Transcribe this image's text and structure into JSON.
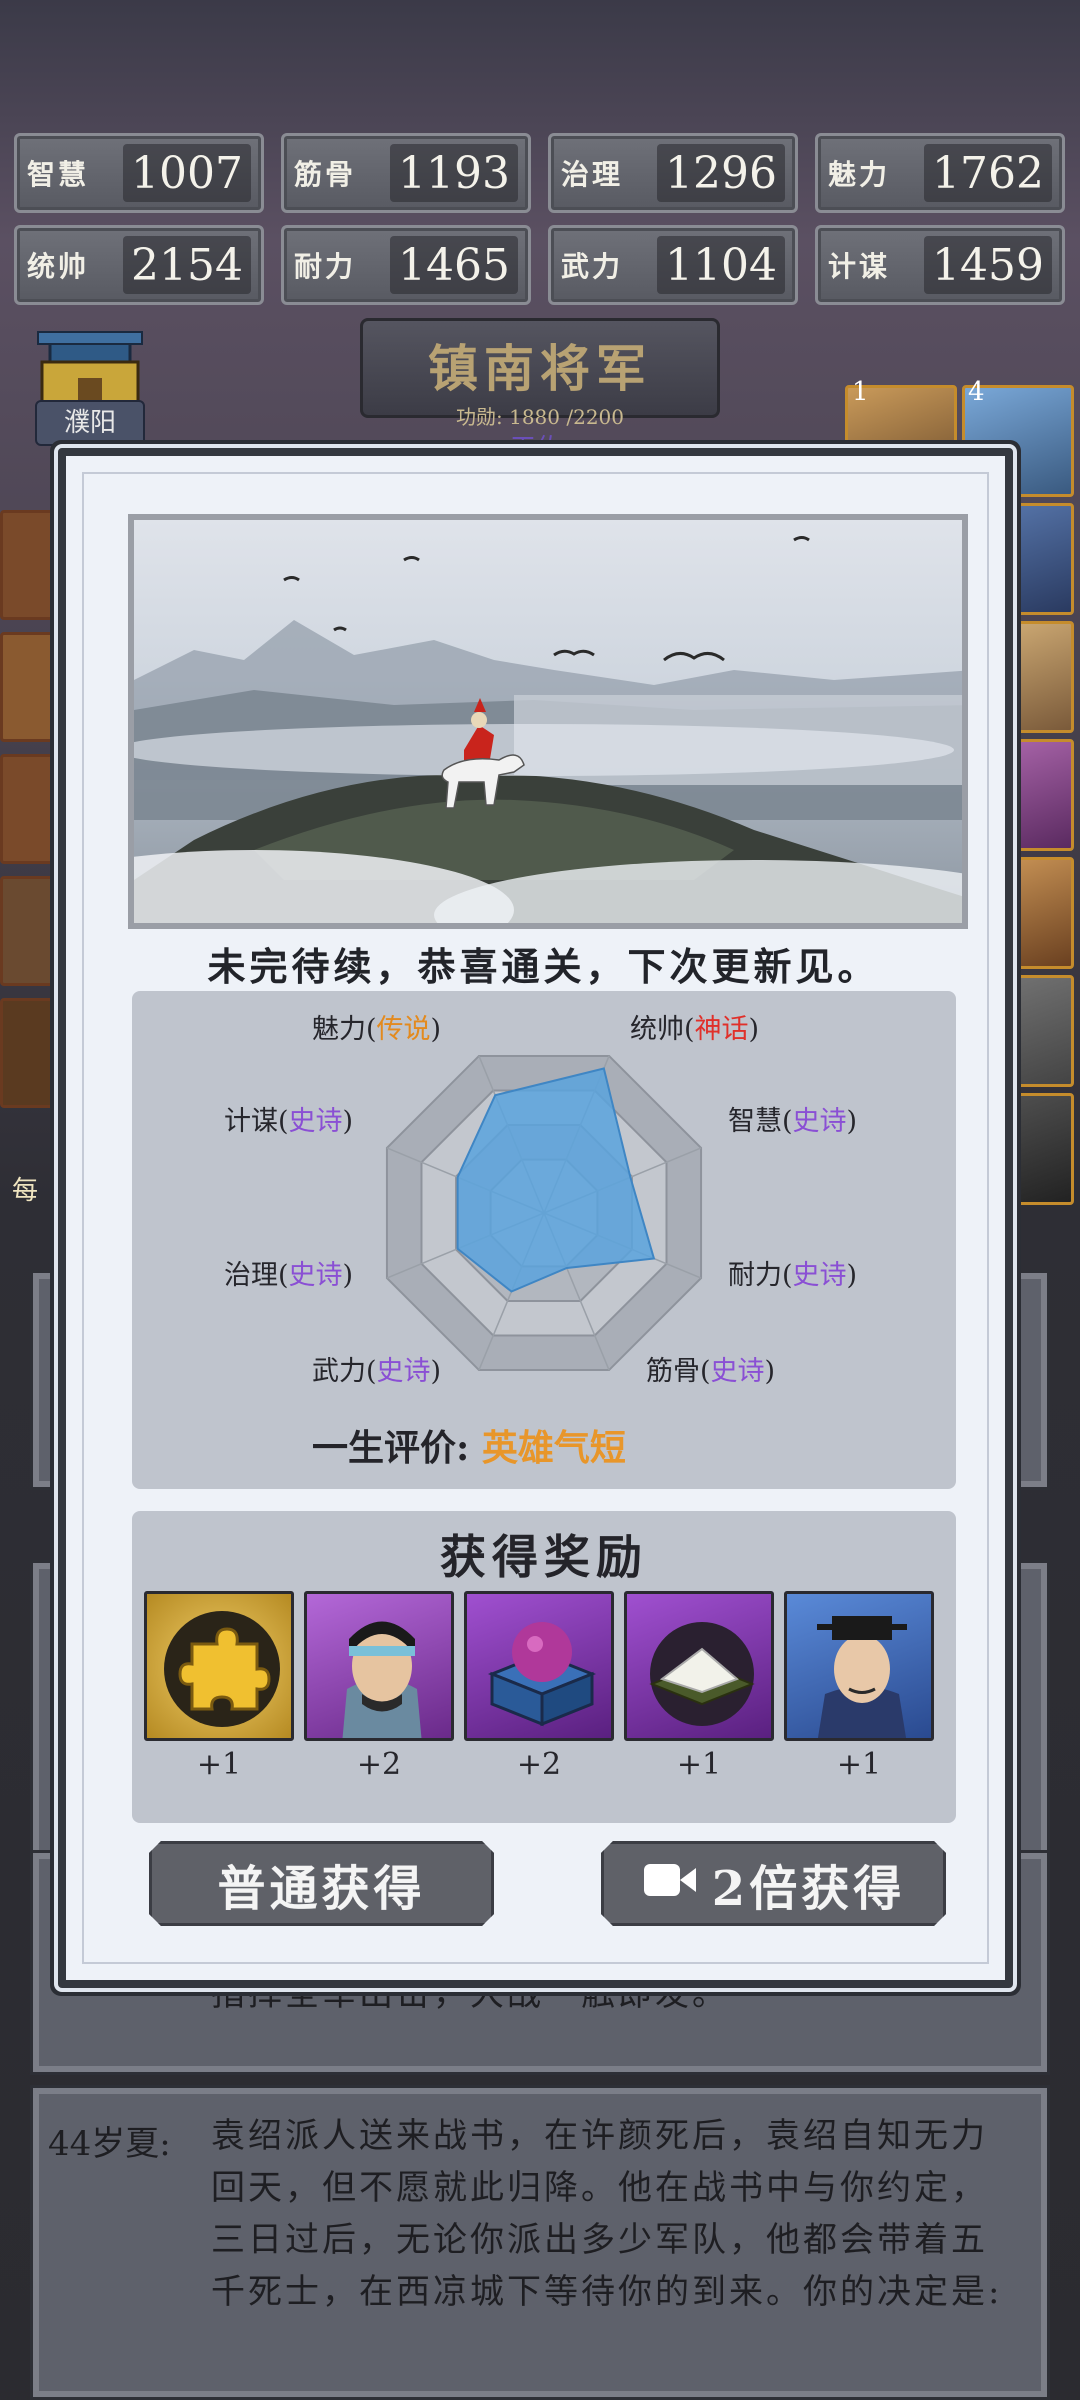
{
  "stats": [
    {
      "name": "智慧",
      "value": "1007"
    },
    {
      "name": "筋骨",
      "value": "1193"
    },
    {
      "name": "治理",
      "value": "1296"
    },
    {
      "name": "魅力",
      "value": "1762"
    },
    {
      "name": "统帅",
      "value": "2154"
    },
    {
      "name": "耐力",
      "value": "1465"
    },
    {
      "name": "武力",
      "value": "1104"
    },
    {
      "name": "计谋",
      "value": "1459"
    }
  ],
  "rank": {
    "title": "镇南将军",
    "merit": "功勋: 1880 /2200",
    "subtitle": "天佐"
  },
  "city": {
    "name": "濮阳"
  },
  "portrait_badges": [
    "1",
    "4"
  ],
  "daily_label": "每",
  "dialog": {
    "ending_text": "未完待续，恭喜通关，下次更新见。",
    "attributes": [
      {
        "name": "统帅",
        "quality": "神话",
        "level": 0.92
      },
      {
        "name": "智慧",
        "quality": "史诗",
        "level": 0.55
      },
      {
        "name": "耐力",
        "quality": "史诗",
        "level": 0.7
      },
      {
        "name": "筋骨",
        "quality": "史诗",
        "level": 0.35
      },
      {
        "name": "武力",
        "quality": "史诗",
        "level": 0.5
      },
      {
        "name": "治理",
        "quality": "史诗",
        "level": 0.55
      },
      {
        "name": "计谋",
        "quality": "史诗",
        "level": 0.55
      },
      {
        "name": "魅力",
        "quality": "传说",
        "level": 0.75
      }
    ],
    "life_eval_label": "一生评价: ",
    "life_eval_value": "英雄气短",
    "reward_title": "获得奖励",
    "rewards": [
      {
        "icon": "puzzle-piece-icon",
        "count": "+1"
      },
      {
        "icon": "general-portrait-icon",
        "count": "+2"
      },
      {
        "icon": "treasure-chest-icon",
        "count": "+2"
      },
      {
        "icon": "food-plate-icon",
        "count": "+1"
      },
      {
        "icon": "official-portrait-icon",
        "count": "+1"
      }
    ],
    "normal_button": "普通获得",
    "double_button": "2倍获得"
  },
  "log": [
    {
      "age": "",
      "text": "指挥全军出击，大战一触即发。"
    },
    {
      "age": "44岁夏:",
      "text": "袁绍派人送来战书，在许颜死后，袁绍自知无力回天，但不愿就此归降。他在战书中与你约定，三日过后，无论你派出多少军队，他都会带着五千死士，在西凉城下等待你的到来。你的决定是:"
    }
  ],
  "colors": {
    "epic": "#8a4fd4",
    "legend": "#e38a1e",
    "myth": "#e0302a",
    "radar_fill": "#5aa3dd"
  }
}
